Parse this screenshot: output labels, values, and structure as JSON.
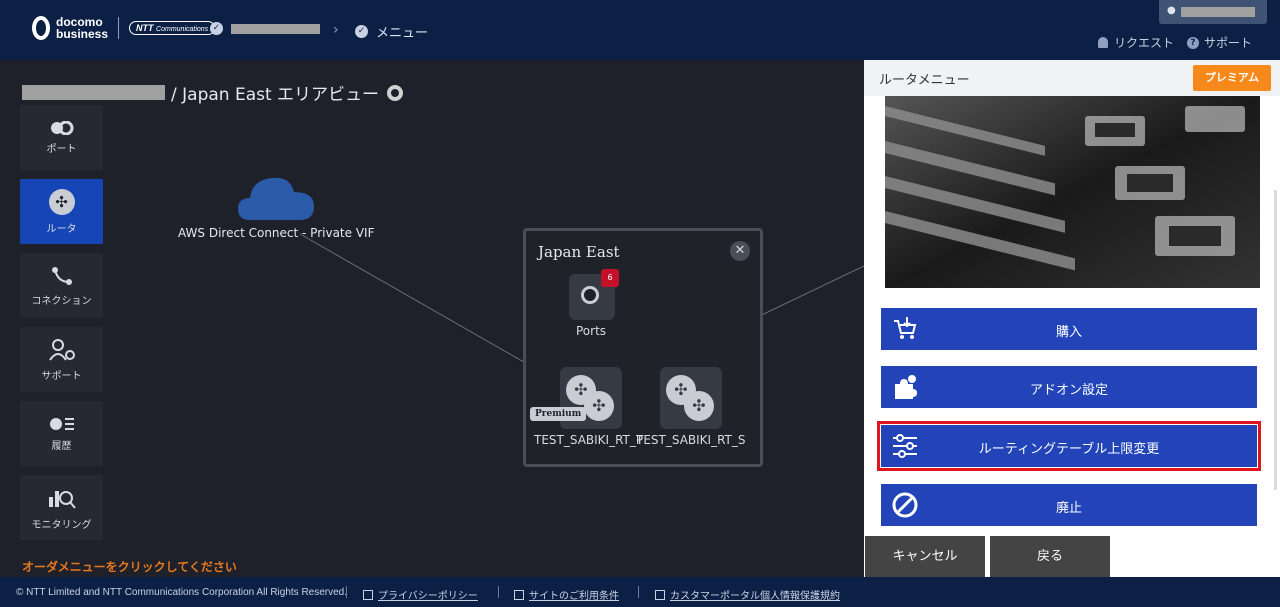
{
  "header": {
    "logo_line1": "docomo",
    "logo_line2": "business",
    "ntt_logo": "NTT",
    "ntt_logo_sub": "Communications",
    "breadcrumb_current": "メニュー",
    "request_label": "リクエスト",
    "support_label": "サポート"
  },
  "page": {
    "title": "/ Japan East エリアビュー",
    "order_hint": "オーダメニューをクリックしてください"
  },
  "sidebar": {
    "items": [
      {
        "label": "ポート",
        "icon": "ports-icon"
      },
      {
        "label": "ルータ",
        "icon": "router-icon",
        "active": true
      },
      {
        "label": "コネクション",
        "icon": "connection-icon"
      },
      {
        "label": "サポート",
        "icon": "support-icon"
      },
      {
        "label": "履歴",
        "icon": "history-icon"
      },
      {
        "label": "モニタリング",
        "icon": "monitoring-icon"
      }
    ]
  },
  "canvas": {
    "cloud_label": "AWS Direct Connect - Private VIF",
    "region": {
      "title": "Japan East",
      "ports_label": "Ports",
      "ports_badge": "6",
      "premium_tag": "Premium",
      "router1_label": "TEST_SABIKI_RT_P",
      "router2_label": "TEST_SABIKI_RT_S"
    }
  },
  "panel": {
    "title": "ルータメニュー",
    "premium_button": "プレミアム",
    "menu": [
      {
        "label": "購入",
        "icon": "cart-icon"
      },
      {
        "label": "アドオン設定",
        "icon": "puzzle-icon"
      },
      {
        "label": "ルーティングテーブル上限変更",
        "icon": "sliders-icon",
        "highlighted": true
      },
      {
        "label": "廃止",
        "icon": "prohibit-icon"
      }
    ],
    "cancel_button": "キャンセル",
    "back_button": "戻る"
  },
  "footer": {
    "copyright": "© NTT Limited and NTT Communications Corporation All Rights Reserved.",
    "links": [
      "プライバシーポリシー",
      "サイトのご利用条件",
      "カスタマーポータル個人情報保護規約"
    ]
  },
  "colors": {
    "header_bg": "#0c2046",
    "canvas_bg": "#1e2129",
    "accent_blue": "#2244b8",
    "premium_orange": "#f7891b",
    "highlight_red": "#e01520",
    "hint_orange": "#e8781e"
  }
}
